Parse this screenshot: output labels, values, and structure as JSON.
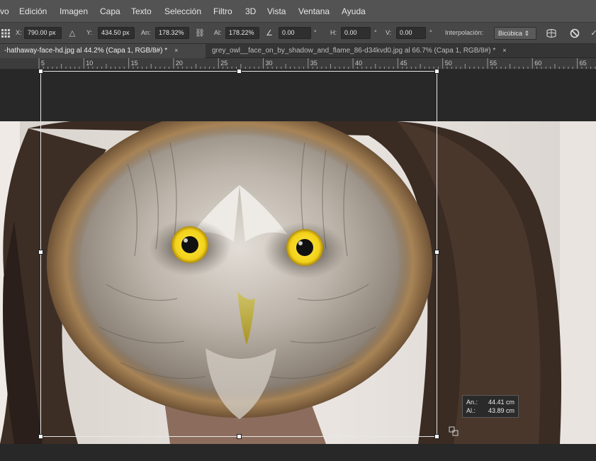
{
  "menu": {
    "items": [
      "vo",
      "Edición",
      "Imagen",
      "Capa",
      "Texto",
      "Selección",
      "Filtro",
      "3D",
      "Vista",
      "Ventana",
      "Ayuda"
    ]
  },
  "options": {
    "x_label": "X:",
    "x_value": "790.00 px",
    "y_label": "Y:",
    "y_value": "434.50 px",
    "w_label": "An:",
    "w_value": "178.32%",
    "h_label": "Al:",
    "h_value": "178.22%",
    "angle_value": "0.00",
    "angle_unit": "°",
    "hskew_label": "H:",
    "hskew_value": "0.00",
    "hskew_unit": "°",
    "vskew_label": "V:",
    "vskew_value": "0.00",
    "vskew_unit": "°",
    "interp_label": "Interpolación:",
    "interp_value": "Bicúbica"
  },
  "tabs": [
    {
      "label": "-hathaway-face-hd.jpg al 44.2% (Capa 1, RGB/8#) *",
      "close": "×",
      "active": true
    },
    {
      "label": "grey_owl__face_on_by_shadow_and_flame_86-d34kvd0.jpg al 66.7% (Capa 1, RGB/8#) *",
      "close": "×",
      "active": false
    }
  ],
  "ruler": {
    "labels": [
      "5",
      "10",
      "15",
      "20",
      "25",
      "30",
      "35",
      "40",
      "45",
      "50",
      "55",
      "60",
      "65"
    ]
  },
  "transform_info": {
    "width_label": "An.:",
    "width_value": "44.41 cm",
    "height_label": "Al.:",
    "height_value": "43.89 cm"
  },
  "colors": {
    "menubar": "#535353",
    "optionsbar": "#474747",
    "canvas_bg": "#282828",
    "owl_eye": "#f2d21a"
  },
  "icons": [
    "reference-point-icon",
    "link-icon",
    "angle-icon",
    "warp-icon",
    "cancel-icon",
    "commit-icon"
  ]
}
